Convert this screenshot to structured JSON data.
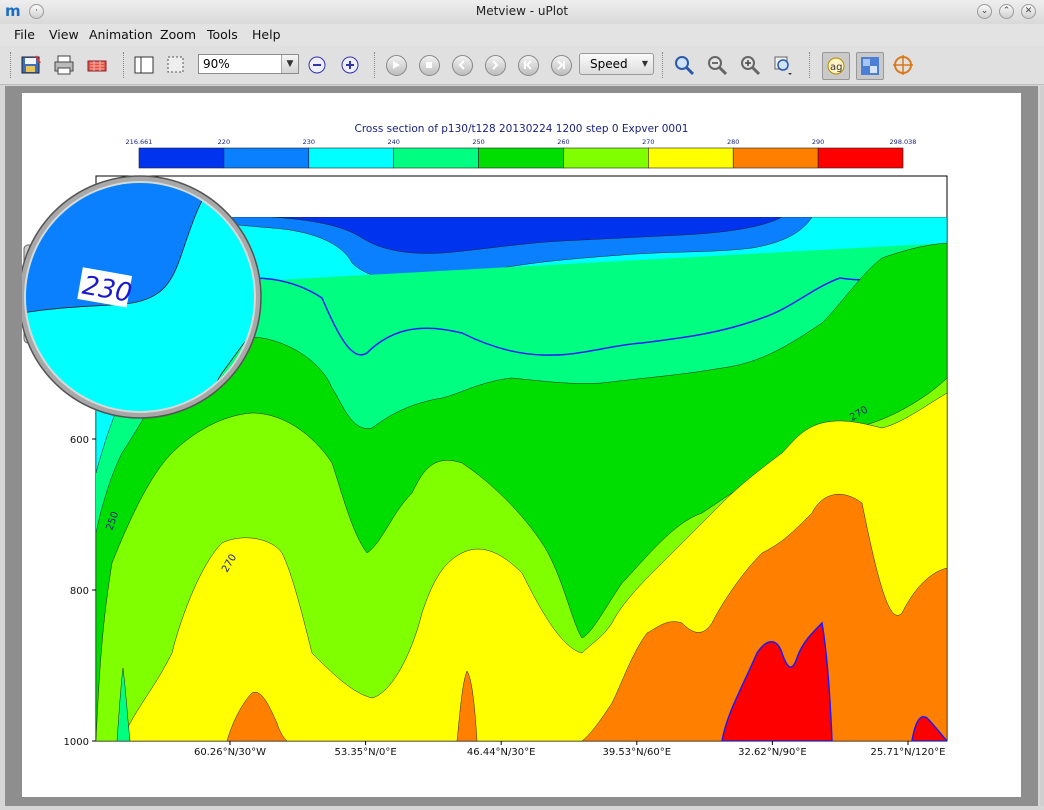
{
  "window": {
    "title": "Metview - uPlot"
  },
  "menu": [
    "File",
    "View",
    "Animation",
    "Zoom",
    "Tools",
    "Help"
  ],
  "toolbar": {
    "zoom_value": "90%",
    "speed_label": "Speed"
  },
  "icons": [
    "metview-logo-icon",
    "save-icon",
    "print-icon",
    "export-icon",
    "sidebar-icon",
    "area-select-icon",
    "zoom-out-icon",
    "zoom-in-icon",
    "play-icon",
    "stop-icon",
    "previous-icon",
    "next-icon",
    "first-frame-icon",
    "last-frame-icon",
    "magnifier-icon",
    "zoom-out-magnifier-icon",
    "zoom-in-magnifier-icon",
    "zoom-stack-icon",
    "data-inspector-icon",
    "layer-icon",
    "crosshair-icon"
  ],
  "chart_data": {
    "type": "heatmap",
    "title": "Cross section of p130/t128 20130224 1200 step 0 Expver 0001",
    "legend": {
      "ticks": [
        "216.661",
        "220",
        "230",
        "240",
        "250",
        "260",
        "270",
        "280",
        "290",
        "298.038"
      ],
      "colors": [
        "#0033ee",
        "#0a80ff",
        "#00ffff",
        "#00ff80",
        "#00dd00",
        "#80ff00",
        "#ffff00",
        "#ff8000",
        "#ff0000"
      ]
    },
    "y_ticks": [
      "600",
      "800",
      "1000"
    ],
    "x_ticks": [
      "60.26°N/30°W",
      "53.35°N/0°E",
      "46.44°N/30°E",
      "39.53°N/60°E",
      "32.62°N/90°E",
      "25.71°N/120°E"
    ],
    "contour_labels": [
      "250",
      "270",
      "270"
    ],
    "magnifier_label": "230"
  }
}
